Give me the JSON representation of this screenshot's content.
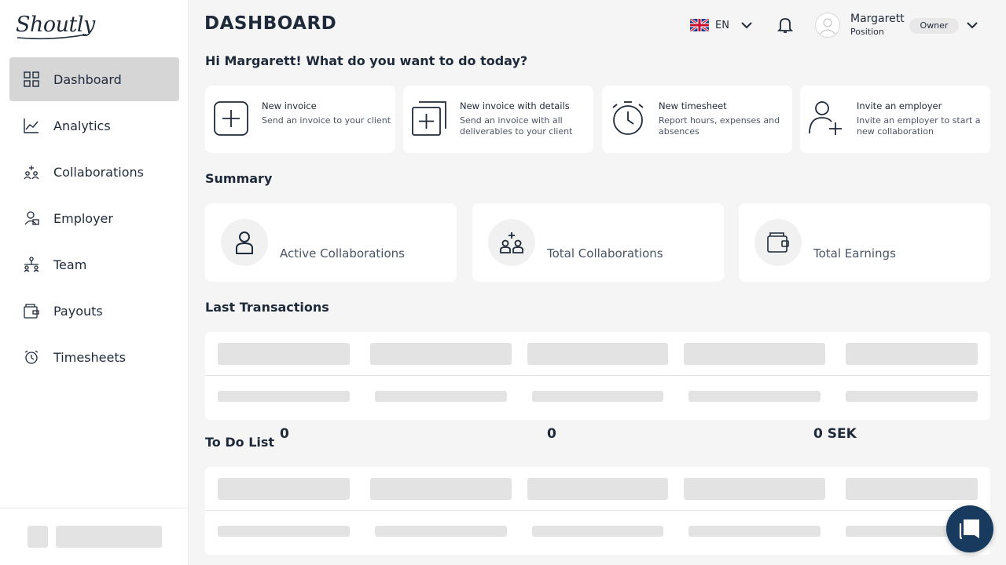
{
  "app": {
    "logo_text": "Shoutly"
  },
  "sidebar": {
    "items": [
      {
        "label": "Dashboard",
        "icon": "grid-icon",
        "active": true
      },
      {
        "label": "Analytics",
        "icon": "chart-icon",
        "active": false
      },
      {
        "label": "Collaborations",
        "icon": "people-icon",
        "active": false
      },
      {
        "label": "Employer",
        "icon": "employer-icon",
        "active": false
      },
      {
        "label": "Team",
        "icon": "team-icon",
        "active": false
      },
      {
        "label": "Payouts",
        "icon": "wallet-icon",
        "active": false
      },
      {
        "label": "Timesheets",
        "icon": "stopwatch-icon",
        "active": false
      }
    ]
  },
  "header": {
    "title": "DASHBOARD",
    "language": "EN",
    "user": {
      "name": "Margarett",
      "position": "Position",
      "role": "Owner"
    }
  },
  "greeting": "Hi Margarett! What do you want to do today?",
  "actions": [
    {
      "title": "New invoice",
      "description": "Send an invoice to your client",
      "icon": "plus-square-icon"
    },
    {
      "title": "New invoice with details",
      "description": "Send an invoice with all deliverables to your client",
      "icon": "plus-stack-icon"
    },
    {
      "title": "New timesheet",
      "description": "Report hours, expenses and absences",
      "icon": "stopwatch-icon"
    },
    {
      "title": "Invite an employer",
      "description": "Invite an employer to start a new collaboration",
      "icon": "add-user-icon"
    }
  ],
  "summary": {
    "title": "Summary",
    "cards": [
      {
        "value": "0",
        "label": "Active Collaborations",
        "icon": "person-icon"
      },
      {
        "value": "0",
        "label": "Total Collaborations",
        "icon": "people-icon"
      },
      {
        "value": "0 SEK",
        "label": "Total Earnings",
        "icon": "wallet-icon"
      }
    ]
  },
  "transactions": {
    "title": "Last Transactions"
  },
  "todo": {
    "title": "To Do List"
  },
  "colors": {
    "primary": "#1e2a3a",
    "active_nav": "#d6d6d6",
    "chat": "#173a5e",
    "skeleton": "#e3e3e3"
  }
}
